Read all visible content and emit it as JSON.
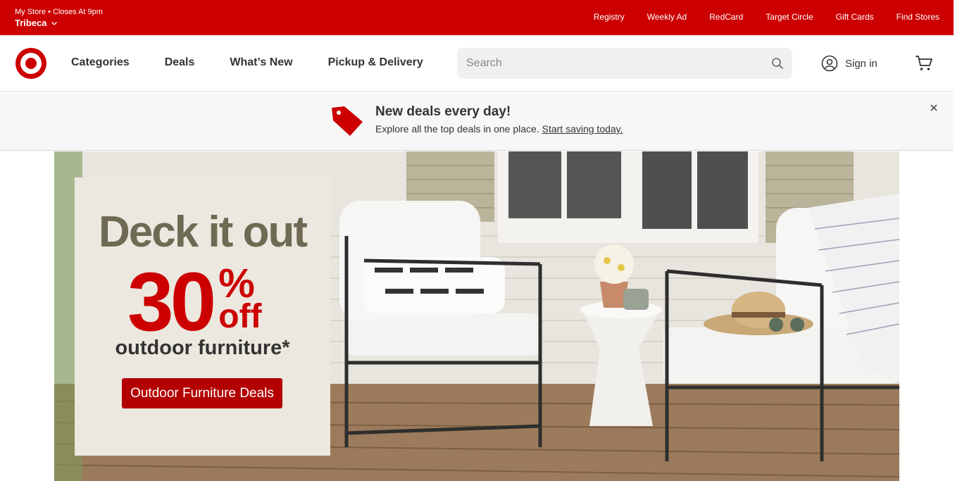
{
  "utility": {
    "store_line": "My Store • Closes At 9pm",
    "store_name": "Tribeca",
    "links": [
      "Registry",
      "Weekly Ad",
      "RedCard",
      "Target Circle",
      "Gift Cards",
      "Find Stores"
    ]
  },
  "header": {
    "nav": [
      "Categories",
      "Deals",
      "What’s New",
      "Pickup & Delivery"
    ],
    "search_placeholder": "Search",
    "signin_label": "Sign in"
  },
  "promo": {
    "title": "New deals every day!",
    "text": "Explore all the top deals in one place.",
    "link": "Start saving today."
  },
  "hero": {
    "headline": "Deck it out",
    "discount_number": "30",
    "discount_symbol": "%",
    "discount_off": "off",
    "subtitle": "outdoor furniture*",
    "cta_label": "Outdoor Furniture Deals"
  },
  "colors": {
    "brand_red": "#cc0000",
    "cta_red": "#b30000",
    "headline_olive": "#6e6a53",
    "card_bg": "#ece8df"
  },
  "icons": [
    "chevron-down-icon",
    "target-bullseye-logo",
    "search-icon",
    "user-account-icon",
    "cart-icon",
    "price-tag-icon",
    "close-icon"
  ]
}
